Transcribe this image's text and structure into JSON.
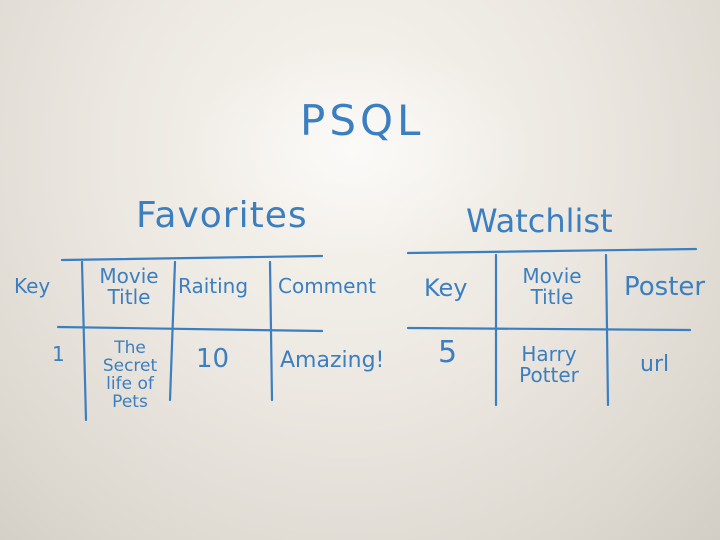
{
  "board_title": "PSQL",
  "favorites": {
    "title": "Favorites",
    "headers": [
      "Key",
      "Movie Title",
      "Raiting",
      "Comment"
    ],
    "row": [
      "1",
      "The Secret life of Pets",
      "10",
      "Amazing!"
    ]
  },
  "watchlist": {
    "title": "Watchlist",
    "headers": [
      "Key",
      "Movie Title",
      "Poster"
    ],
    "row": [
      "5",
      "Harry Potter",
      "url"
    ]
  },
  "colors": {
    "marker": "#3b7fc0",
    "board": "#ece8e1"
  }
}
